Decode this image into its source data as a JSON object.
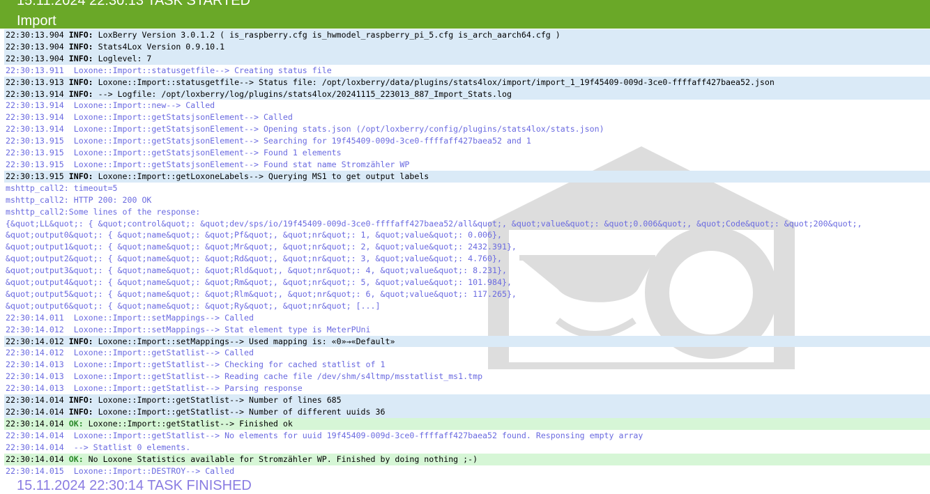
{
  "header": {
    "started_text": "15.11.2024 22:30:13 TASK STARTED",
    "title": "Import"
  },
  "log_lines": [
    {
      "type": "info",
      "time": "22:30:13.904",
      "level": "INFO:",
      "msg": " LoxBerry Version 3.0.1.2 ( is_raspberry.cfg is_hwmodel_raspberry_pi_5.cfg is_arch_aarch64.cfg )"
    },
    {
      "type": "info",
      "time": "22:30:13.904",
      "level": "INFO:",
      "msg": " Stats4Lox Version 0.9.10.1"
    },
    {
      "type": "info",
      "time": "22:30:13.904",
      "level": "INFO:",
      "msg": " Loglevel: 7"
    },
    {
      "type": "debug",
      "time": "22:30:13.911",
      "level": "",
      "msg": " Loxone::Import::statusgetfile--> Creating status file"
    },
    {
      "type": "info",
      "time": "22:30:13.913",
      "level": "INFO:",
      "msg": " Loxone::Import::statusgetfile--> Status file: /opt/loxberry/data/plugins/stats4lox/import/import_1_19f45409-009d-3ce0-ffffaff427baea52.json"
    },
    {
      "type": "info",
      "time": "22:30:13.914",
      "level": "INFO:",
      "msg": " --> Logfile: /opt/loxberry/log/plugins/stats4lox/20241115_223013_887_Import_Stats.log"
    },
    {
      "type": "debug",
      "time": "22:30:13.914",
      "level": "",
      "msg": " Loxone::Import::new--> Called"
    },
    {
      "type": "debug",
      "time": "22:30:13.914",
      "level": "",
      "msg": " Loxone::Import::getStatsjsonElement--> Called"
    },
    {
      "type": "debug",
      "time": "22:30:13.914",
      "level": "",
      "msg": " Loxone::Import::getStatsjsonElement--> Opening stats.json (/opt/loxberry/config/plugins/stats4lox/stats.json)"
    },
    {
      "type": "debug",
      "time": "22:30:13.915",
      "level": "",
      "msg": " Loxone::Import::getStatsjsonElement--> Searching for 19f45409-009d-3ce0-ffffaff427baea52 and 1"
    },
    {
      "type": "debug",
      "time": "22:30:13.915",
      "level": "",
      "msg": " Loxone::Import::getStatsjsonElement--> Found 1 elements"
    },
    {
      "type": "debug",
      "time": "22:30:13.915",
      "level": "",
      "msg": " Loxone::Import::getStatsjsonElement--> Found stat name Stromzähler WP"
    },
    {
      "type": "info",
      "time": "22:30:13.915",
      "level": "INFO:",
      "msg": " Loxone::Import::getLoxoneLabels--> Querying MS1 to get output labels"
    },
    {
      "type": "plain",
      "time": "",
      "level": "",
      "msg": "mshttp_call2: timeout=5"
    },
    {
      "type": "plain",
      "time": "",
      "level": "",
      "msg": "mshttp_call2: HTTP 200: 200 OK"
    },
    {
      "type": "plain",
      "time": "",
      "level": "",
      "msg": "mshttp_call2:Some lines of the response:"
    },
    {
      "type": "plain",
      "time": "",
      "level": "",
      "msg": "{&quot;LL&quot;: { &quot;control&quot;: &quot;dev/sps/io/19f45409-009d-3ce0-ffffaff427baea52/all&quot;, &quot;value&quot;: &quot;0.006&quot;, &quot;Code&quot;: &quot;200&quot;,"
    },
    {
      "type": "plain",
      "time": "",
      "level": "",
      "msg": "&quot;output0&quot;: { &quot;name&quot;: &quot;Pf&quot;, &quot;nr&quot;: 1, &quot;value&quot;: 0.006},"
    },
    {
      "type": "plain",
      "time": "",
      "level": "",
      "msg": "&quot;output1&quot;: { &quot;name&quot;: &quot;Mr&quot;, &quot;nr&quot;: 2, &quot;value&quot;: 2432.391},"
    },
    {
      "type": "plain",
      "time": "",
      "level": "",
      "msg": "&quot;output2&quot;: { &quot;name&quot;: &quot;Rd&quot;, &quot;nr&quot;: 3, &quot;value&quot;: 4.760},"
    },
    {
      "type": "plain",
      "time": "",
      "level": "",
      "msg": "&quot;output3&quot;: { &quot;name&quot;: &quot;Rld&quot;, &quot;nr&quot;: 4, &quot;value&quot;: 8.231},"
    },
    {
      "type": "plain",
      "time": "",
      "level": "",
      "msg": "&quot;output4&quot;: { &quot;name&quot;: &quot;Rm&quot;, &quot;nr&quot;: 5, &quot;value&quot;: 101.984},"
    },
    {
      "type": "plain",
      "time": "",
      "level": "",
      "msg": "&quot;output5&quot;: { &quot;name&quot;: &quot;Rlm&quot;, &quot;nr&quot;: 6, &quot;value&quot;: 117.265},"
    },
    {
      "type": "plain",
      "time": "",
      "level": "",
      "msg": "&quot;output6&quot;: { &quot;name&quot;: &quot;Ry&quot;, &quot;nr&quot; [...]"
    },
    {
      "type": "debug",
      "time": "22:30:14.011",
      "level": "",
      "msg": " Loxone::Import::setMappings--> Called"
    },
    {
      "type": "debug",
      "time": "22:30:14.012",
      "level": "",
      "msg": " Loxone::Import::setMappings--> Stat element type is MeterPUni"
    },
    {
      "type": "info",
      "time": "22:30:14.012",
      "level": "INFO:",
      "msg": " Loxone::Import::setMappings--> Used mapping is: «0»→«Default»"
    },
    {
      "type": "debug",
      "time": "22:30:14.012",
      "level": "",
      "msg": " Loxone::Import::getStatlist--> Called"
    },
    {
      "type": "debug",
      "time": "22:30:14.013",
      "level": "",
      "msg": " Loxone::Import::getStatlist--> Checking for cached statlist of 1"
    },
    {
      "type": "debug",
      "time": "22:30:14.013",
      "level": "",
      "msg": " Loxone::Import::getStatlist--> Reading cache file /dev/shm/s4ltmp/msstatlist_ms1.tmp"
    },
    {
      "type": "debug",
      "time": "22:30:14.013",
      "level": "",
      "msg": " Loxone::Import::getStatlist--> Parsing response"
    },
    {
      "type": "info",
      "time": "22:30:14.014",
      "level": "INFO:",
      "msg": " Loxone::Import::getStatlist--> Number of lines 685"
    },
    {
      "type": "info",
      "time": "22:30:14.014",
      "level": "INFO:",
      "msg": " Loxone::Import::getStatlist--> Number of different uuids 36"
    },
    {
      "type": "ok",
      "time": "22:30:14.014",
      "level": "OK:",
      "msg": " Loxone::Import::getStatlist--> Finished ok"
    },
    {
      "type": "debug",
      "time": "22:30:14.014",
      "level": "",
      "msg": " Loxone::Import::getStatlist--> No elements for uuid 19f45409-009d-3ce0-ffffaff427baea52 found. Responsing empty array"
    },
    {
      "type": "debug",
      "time": "22:30:14.014",
      "level": "",
      "msg": " --> Statlist 0 elements."
    },
    {
      "type": "ok",
      "time": "22:30:14.014",
      "level": "OK:",
      "msg": " No Loxone Statistics available for Stromzähler WP. Finished by doing nothing ;-)"
    },
    {
      "type": "debug",
      "time": "22:30:14.015",
      "level": "",
      "msg": " Loxone::Import::DESTROY--> Called"
    }
  ],
  "footer": {
    "finished_text": "15.11.2024 22:30:14 TASK FINISHED"
  },
  "colors": {
    "header_bg": "#6aa828",
    "info_bg": "#daeaf7",
    "ok_bg": "#d6f6d6",
    "debug_text": "#6a6ae0",
    "ok_label": "#2a8a2a",
    "footer_text": "#8a7ce2"
  },
  "icons": {
    "watermark": "loxberry-logo-icon"
  }
}
